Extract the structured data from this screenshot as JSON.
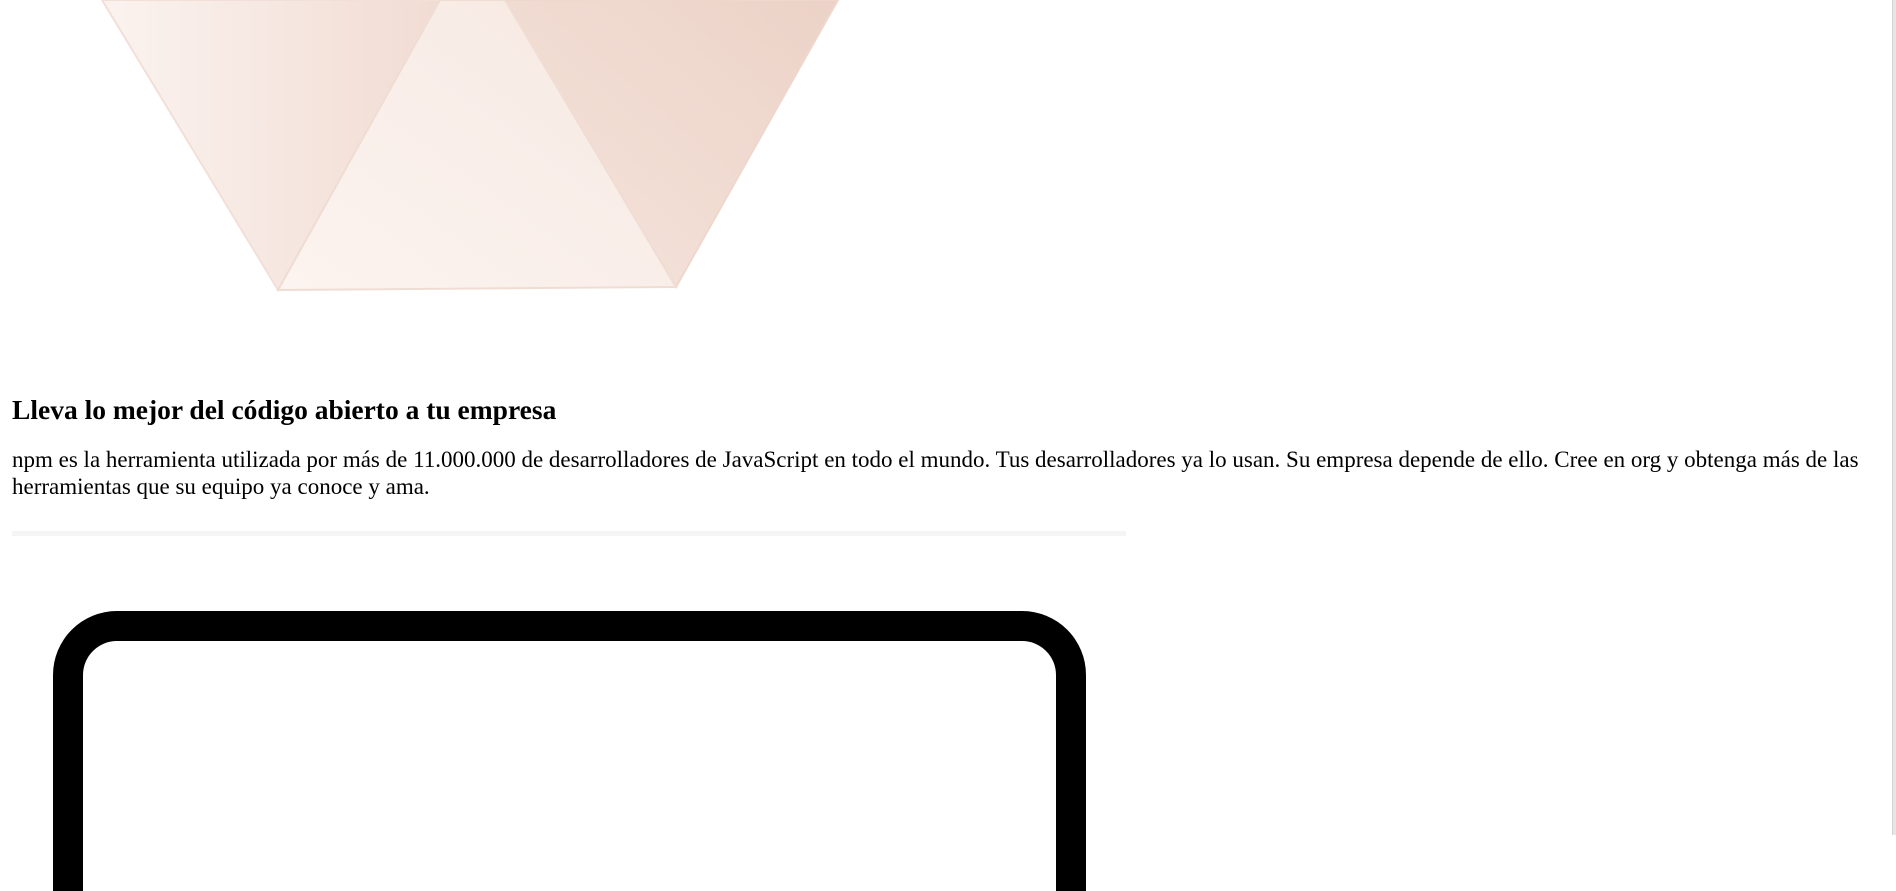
{
  "section": {
    "heading": "Lleva lo mejor del código abierto a tu empresa",
    "description": "npm es la herramienta utilizada por más de 11.000.000 de desarrolladores de JavaScript en todo el mundo. Tus desarrolladores ya lo usan. Su empresa depende de ello. Cree en org y obtenga más de las herramientas que su equipo ya conoce y ama."
  },
  "illustration": {
    "colors": {
      "triangle_light": "#fbf1ec",
      "triangle_mid": "#f3ddd4",
      "triangle_dark": "#eed4ca",
      "triangle_edge": "#efd9cf"
    }
  },
  "device": {
    "frame_color": "#000000"
  }
}
